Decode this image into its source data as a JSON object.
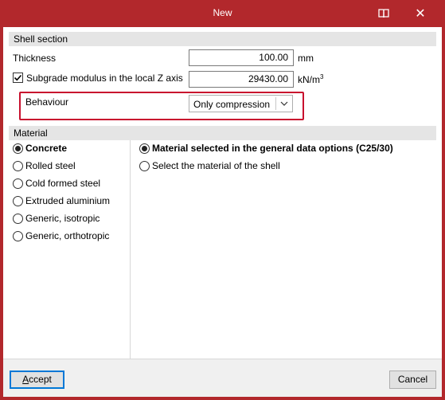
{
  "window": {
    "title": "New",
    "close_glyph": "✕"
  },
  "shell_section": {
    "header": "Shell section",
    "thickness": {
      "label": "Thickness",
      "value": "100.00",
      "unit": "mm"
    },
    "subgrade": {
      "label": "Subgrade modulus in the local Z axis",
      "checked": true,
      "value": "29430.00",
      "unit": "kN/m",
      "unit_sup": "3"
    },
    "behaviour": {
      "label": "Behaviour",
      "selected": "Only compression"
    }
  },
  "material": {
    "header": "Material",
    "types": [
      {
        "label": "Concrete",
        "checked": true,
        "bold": true
      },
      {
        "label": "Rolled steel",
        "checked": false
      },
      {
        "label": "Cold formed steel",
        "checked": false
      },
      {
        "label": "Extruded aluminium",
        "checked": false
      },
      {
        "label": "Generic, isotropic",
        "checked": false
      },
      {
        "label": "Generic, orthotropic",
        "checked": false
      }
    ],
    "options": [
      {
        "label": "Material selected in the general data options (C25/30)",
        "checked": true,
        "bold": true
      },
      {
        "label": "Select the material of the shell",
        "checked": false
      }
    ]
  },
  "footer": {
    "accept_first": "A",
    "accept_rest": "ccept",
    "cancel": "Cancel"
  },
  "colors": {
    "titlebar": "#b2282c",
    "highlight": "#c8102e",
    "accept_border": "#0078d7"
  }
}
